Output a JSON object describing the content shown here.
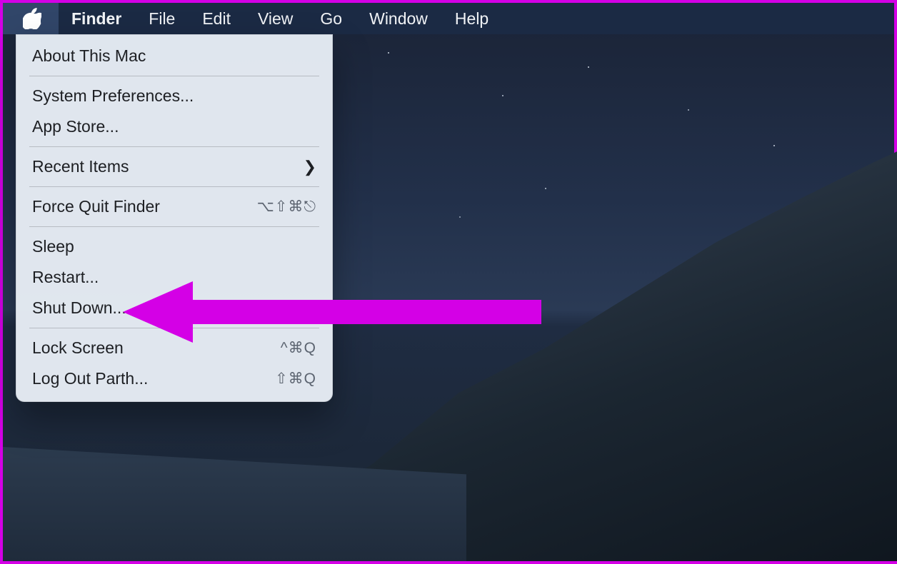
{
  "menubar": {
    "app": "Finder",
    "items": [
      "File",
      "Edit",
      "View",
      "Go",
      "Window",
      "Help"
    ]
  },
  "apple_menu": {
    "about": "About This Mac",
    "sys_prefs": "System Preferences...",
    "app_store": "App Store...",
    "recent_items": "Recent Items",
    "force_quit": "Force Quit Finder",
    "force_quit_shortcut": "⌥⇧⌘⎋",
    "sleep": "Sleep",
    "restart": "Restart...",
    "shut_down": "Shut Down...",
    "lock_screen": "Lock Screen",
    "lock_screen_shortcut": "^⌘Q",
    "log_out": "Log Out Parth...",
    "log_out_shortcut": "⇧⌘Q"
  },
  "annotation": {
    "arrow_color": "#d400e6"
  }
}
